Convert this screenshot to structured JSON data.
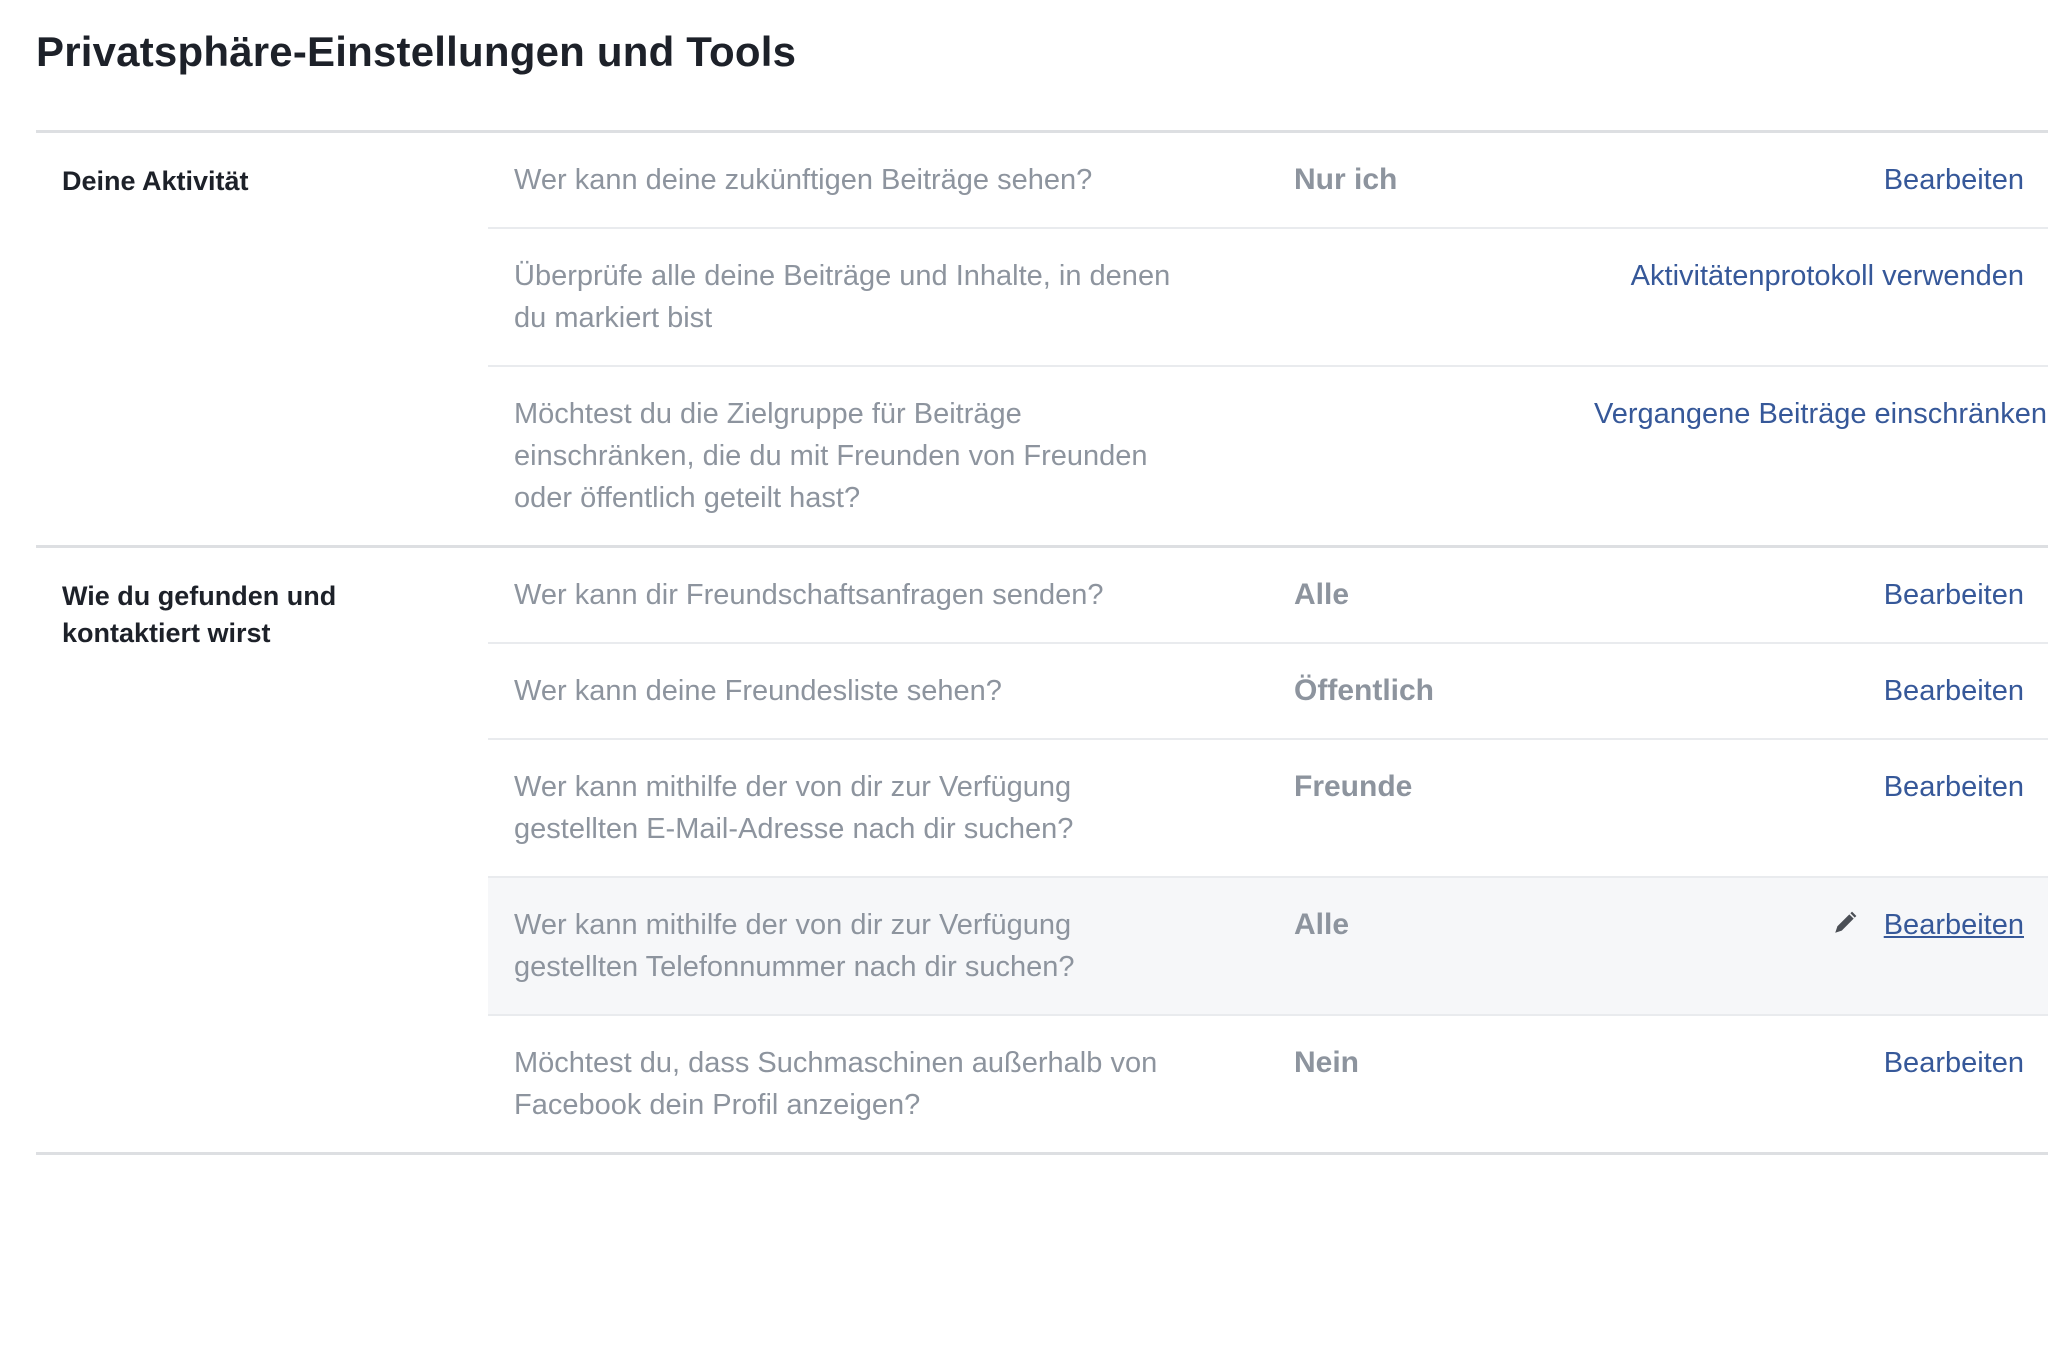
{
  "page_title": "Privatsphäre-Einstellungen und Tools",
  "sections": [
    {
      "label_lines": [
        "Deine Aktivität"
      ],
      "rows": [
        {
          "question": "Wer kann deine zukünftigen Beiträge sehen?",
          "value": "Nur ich",
          "action": "Bearbeiten"
        },
        {
          "question_lines": [
            "Überprüfe alle deine Beiträge und Inhalte, in denen",
            "du markiert bist"
          ],
          "value": "",
          "action": "Aktivitätenprotokoll verwenden"
        },
        {
          "question_lines": [
            "Möchtest du die Zielgruppe für Beiträge",
            "einschränken, die du mit Freunden von Freunden",
            "oder öffentlich geteilt hast?"
          ],
          "value": "",
          "action": "Vergangene Beiträge einschränken"
        }
      ]
    },
    {
      "label_lines": [
        "Wie du gefunden und",
        "kontaktiert wirst"
      ],
      "rows": [
        {
          "question": "Wer kann dir Freundschaftsanfragen senden?",
          "value": "Alle",
          "action": "Bearbeiten"
        },
        {
          "question": "Wer kann deine Freundesliste sehen?",
          "value": "Öffentlich",
          "action": "Bearbeiten"
        },
        {
          "question_lines": [
            "Wer kann mithilfe der von dir zur Verfügung",
            "gestellten E-Mail-Adresse nach dir suchen?"
          ],
          "value": "Freunde",
          "action": "Bearbeiten"
        },
        {
          "question_lines": [
            "Wer kann mithilfe der von dir zur Verfügung",
            "gestellten Telefonnummer nach dir suchen?"
          ],
          "value": "Alle",
          "action": "Bearbeiten",
          "action_icon": "pencil-icon"
        },
        {
          "question_lines": [
            "Möchtest du, dass Suchmaschinen außerhalb von",
            "Facebook dein Profil anzeigen?"
          ],
          "value": "Nein",
          "action": "Bearbeiten"
        }
      ]
    }
  ],
  "colors": {
    "title": "#1d2129",
    "muted_text": "#8d949e",
    "link": "#365899",
    "divider": "#dddfe2",
    "row_divider": "#e9ebee",
    "highlight_bg": "#f6f7f9"
  }
}
